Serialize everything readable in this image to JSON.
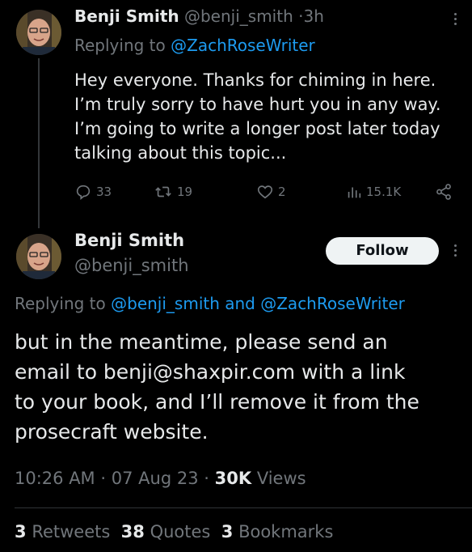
{
  "tweet1": {
    "author_name": "Benji Smith",
    "author_handle": "@benji_smith",
    "separator": "·",
    "time": "3h",
    "replying_prefix": "Replying to",
    "replying_to": "@ZachRoseWriter",
    "body_lines": [
      "Hey everyone. Thanks for chiming in here.",
      "I’m truly sorry to have hurt you in any way.",
      "I’m going to write a longer post later today",
      "talking about this topic..."
    ],
    "actions": {
      "replies": "33",
      "retweets": "19",
      "likes": "2",
      "views": "15.1K"
    }
  },
  "tweet2": {
    "author_name": "Benji Smith",
    "author_handle": "@benji_smith",
    "follow_label": "Follow",
    "replying_prefix": "Replying to",
    "replying_to": "@benji_smith and @ZachRoseWriter",
    "body_lines": [
      "but in the meantime, please send an",
      "email to benji@shaxpir.com with a link",
      "to your book, and I’ll remove it from the",
      "prosecraft website."
    ],
    "time": "10:26 AM",
    "sep": "·",
    "date": "07 Aug 23",
    "views_count": "30K",
    "views_label": "Views",
    "retweets_count": "3",
    "retweets_label": "Retweets",
    "quotes_count": "38",
    "quotes_label": "Quotes",
    "bookmarks_count": "3",
    "bookmarks_label": "Bookmarks"
  },
  "colors": {
    "background": "#000000",
    "text": "#e7e9ea",
    "muted": "#71767b",
    "link": "#1d9bf0",
    "follow_bg": "#eff3f4"
  }
}
